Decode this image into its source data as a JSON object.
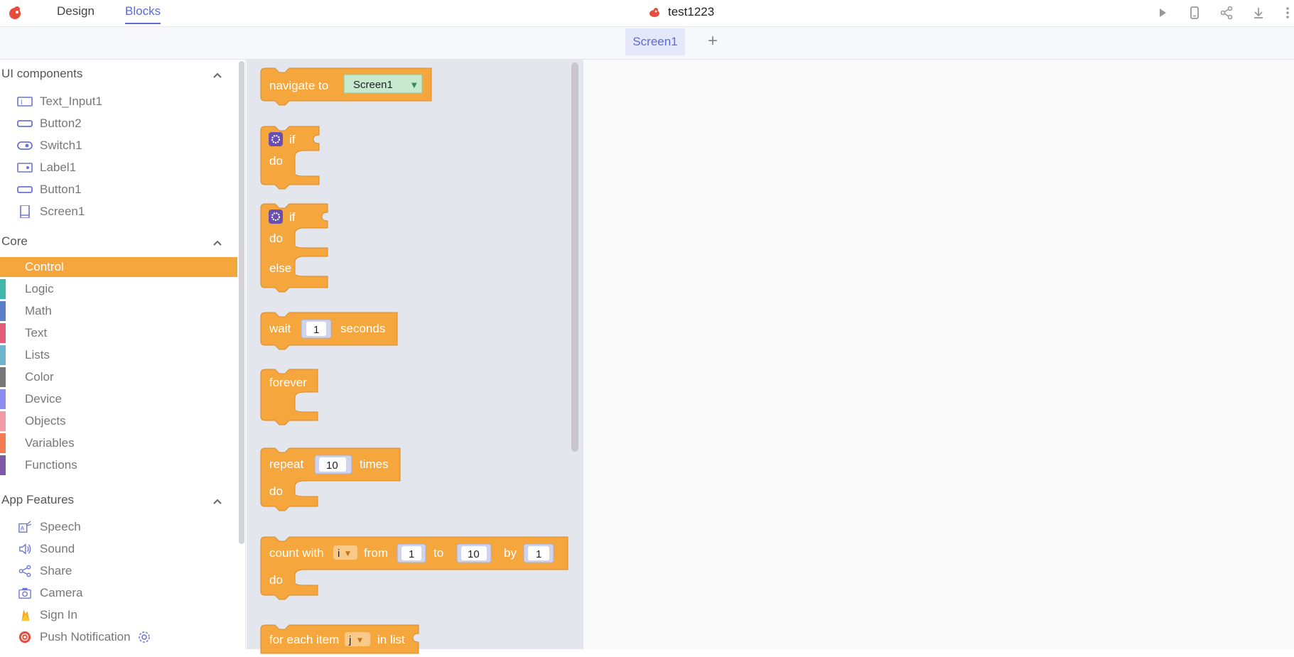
{
  "header": {
    "tabs": [
      {
        "label": "Design"
      },
      {
        "label": "Blocks"
      }
    ],
    "project_name": "test1223",
    "icons": [
      "play-icon",
      "phone-preview-icon",
      "share-icon",
      "download-icon",
      "more-icon"
    ]
  },
  "screens": {
    "active": "Screen1",
    "add": "+"
  },
  "sidebar": {
    "ui_components": {
      "title": "UI components",
      "items": [
        {
          "label": "Text_Input1",
          "icon": "text-input-icon"
        },
        {
          "label": "Button2",
          "icon": "button-icon"
        },
        {
          "label": "Switch1",
          "icon": "switch-icon"
        },
        {
          "label": "Label1",
          "icon": "label-icon"
        },
        {
          "label": "Button1",
          "icon": "button-icon"
        },
        {
          "label": "Screen1",
          "icon": "screen-icon"
        }
      ]
    },
    "core": {
      "title": "Core",
      "items": [
        {
          "label": "Control",
          "color": "#f5a63c"
        },
        {
          "label": "Logic",
          "color": "#3fb8a9"
        },
        {
          "label": "Math",
          "color": "#5b80c9"
        },
        {
          "label": "Text",
          "color": "#e35d78"
        },
        {
          "label": "Lists",
          "color": "#6fb3cf"
        },
        {
          "label": "Color",
          "color": "#777777"
        },
        {
          "label": "Device",
          "color": "#8b8ef0"
        },
        {
          "label": "Objects",
          "color": "#f29aa6"
        },
        {
          "label": "Variables",
          "color": "#f47b52"
        },
        {
          "label": "Functions",
          "color": "#7b5ba6"
        }
      ]
    },
    "app_features": {
      "title": "App Features",
      "items": [
        {
          "label": "Speech",
          "icon": "speech-icon"
        },
        {
          "label": "Sound",
          "icon": "sound-icon"
        },
        {
          "label": "Share",
          "icon": "share-icon"
        },
        {
          "label": "Camera",
          "icon": "camera-icon"
        },
        {
          "label": "Sign In",
          "icon": "firebase-icon"
        },
        {
          "label": "Push Notification",
          "icon": "push-notification-icon"
        }
      ]
    }
  },
  "blocks": {
    "navigate": {
      "label": "navigate to",
      "screen": "Screen1"
    },
    "if1": {
      "if": "if",
      "do": "do"
    },
    "if2": {
      "if": "if",
      "do": "do",
      "else": "else"
    },
    "wait": {
      "label": "wait",
      "value": "1",
      "unit": "seconds"
    },
    "forever": {
      "label": "forever"
    },
    "repeat": {
      "label": "repeat",
      "value": "10",
      "unit": "times",
      "do": "do"
    },
    "count": {
      "label": "count with",
      "var": "i",
      "from": "from",
      "from_val": "1",
      "to": "to",
      "to_val": "10",
      "by": "by",
      "by_val": "1",
      "do": "do"
    },
    "foreach": {
      "label": "for each item",
      "var": "j",
      "in": "in list"
    }
  },
  "colors": {
    "accent": "#5d6ad8",
    "control": "#f5a63c",
    "block_border": "#d98b2a"
  }
}
